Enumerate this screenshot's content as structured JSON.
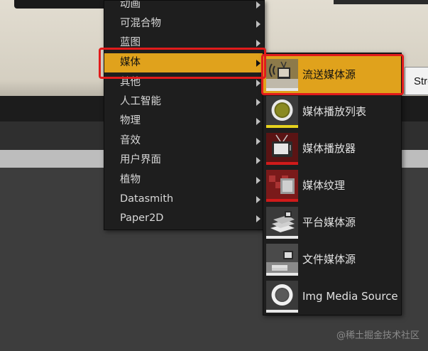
{
  "background": {
    "side_button_label": "Stre"
  },
  "menu": {
    "items": [
      {
        "label": "动画",
        "has_submenu": true,
        "active": false
      },
      {
        "label": "可混合物",
        "has_submenu": true,
        "active": false
      },
      {
        "label": "蓝图",
        "has_submenu": true,
        "active": false
      },
      {
        "label": "媒体",
        "has_submenu": true,
        "active": true
      },
      {
        "label": "其他",
        "has_submenu": true,
        "active": false
      },
      {
        "label": "人工智能",
        "has_submenu": true,
        "active": false
      },
      {
        "label": "物理",
        "has_submenu": true,
        "active": false
      },
      {
        "label": "音效",
        "has_submenu": true,
        "active": false
      },
      {
        "label": "用户界面",
        "has_submenu": true,
        "active": false
      },
      {
        "label": "植物",
        "has_submenu": true,
        "active": false
      },
      {
        "label": "Datasmith",
        "has_submenu": true,
        "active": false
      },
      {
        "label": "Paper2D",
        "has_submenu": true,
        "active": false
      }
    ]
  },
  "submenu": {
    "items": [
      {
        "label": "流送媒体源",
        "icon": "streaming-media-source-icon",
        "strip_color": "#e8e8e8",
        "active": true
      },
      {
        "label": "媒体播放列表",
        "icon": "media-playlist-icon",
        "strip_color": "#e6d21e",
        "active": false
      },
      {
        "label": "媒体播放器",
        "icon": "media-player-icon",
        "strip_color": "#d11a1a",
        "active": false
      },
      {
        "label": "媒体纹理",
        "icon": "media-texture-icon",
        "strip_color": "#d11a1a",
        "active": false
      },
      {
        "label": "平台媒体源",
        "icon": "platform-media-source-icon",
        "strip_color": "#e8e8e8",
        "active": false
      },
      {
        "label": "文件媒体源",
        "icon": "file-media-source-icon",
        "strip_color": "#e8e8e8",
        "active": false
      },
      {
        "label": "Img Media Source",
        "icon": "img-media-source-icon",
        "strip_color": "#e8e8e8",
        "active": false
      }
    ]
  },
  "colors": {
    "accent": "#e0a21c",
    "highlight": "#e11b1b",
    "menu_bg": "#1e1e1e"
  },
  "watermark": "@稀土掘金技术社区"
}
